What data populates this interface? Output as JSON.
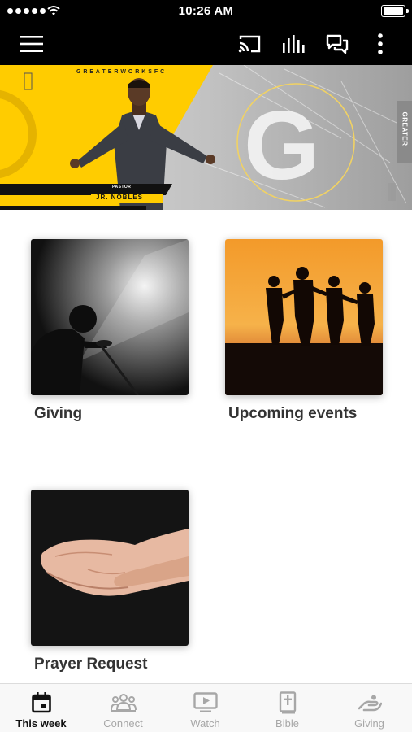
{
  "status_bar": {
    "time": "10:26 AM"
  },
  "hero": {
    "pastor_prefix": "PASTOR",
    "pastor_name": "JR. NOBLES",
    "brand_top": "G R E A T E R W O R K S F C",
    "side_tag": "GREATER"
  },
  "cards": [
    {
      "label": "Giving"
    },
    {
      "label": "Upcoming events"
    },
    {
      "label": "Prayer Request"
    }
  ],
  "tabbar": {
    "tabs": [
      {
        "label": "This week",
        "icon": "calendar-icon",
        "active": true
      },
      {
        "label": "Connect",
        "icon": "people-icon",
        "active": false
      },
      {
        "label": "Watch",
        "icon": "video-icon",
        "active": false
      },
      {
        "label": "Bible",
        "icon": "bible-icon",
        "active": false
      },
      {
        "label": "Giving",
        "icon": "giving-hand-icon",
        "active": false
      }
    ]
  },
  "colors": {
    "bar": "#000000",
    "brand_yellow": "#FFCC00",
    "active_tab": "#111111",
    "inactive_tab": "#A7A7A7"
  }
}
